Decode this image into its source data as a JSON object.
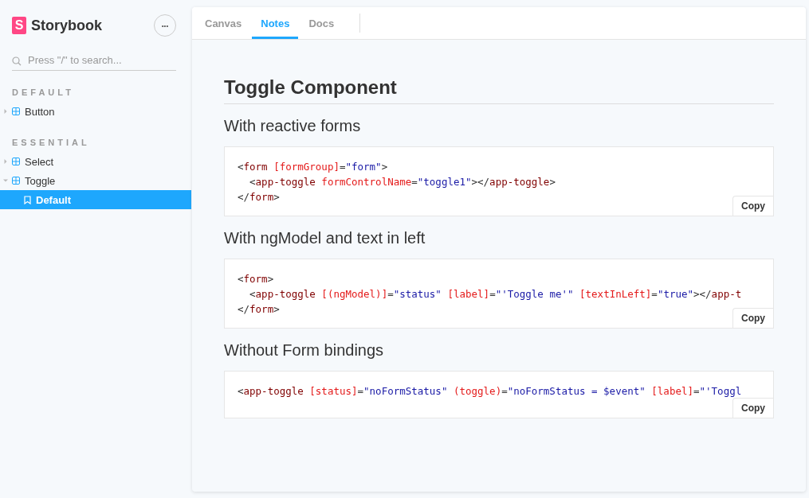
{
  "sidebar": {
    "brand": {
      "logo_letter": "S",
      "name": "Storybook"
    },
    "menu_button": "•••",
    "search": {
      "placeholder": "Press \"/\" to search..."
    },
    "sections": [
      {
        "heading": "DEFAULT",
        "items": [
          {
            "label": "Button",
            "expanded": false,
            "selected": false
          }
        ]
      },
      {
        "heading": "ESSENTIAL",
        "items": [
          {
            "label": "Select",
            "expanded": false,
            "selected": false
          },
          {
            "label": "Toggle",
            "expanded": true,
            "selected": false,
            "children": [
              {
                "label": "Default",
                "selected": true
              }
            ]
          }
        ]
      }
    ]
  },
  "tabs": [
    {
      "label": "Canvas",
      "selected": false
    },
    {
      "label": "Notes",
      "selected": true
    },
    {
      "label": "Docs",
      "selected": false
    }
  ],
  "doc": {
    "title": "Toggle Component",
    "sections": [
      {
        "heading": "With reactive forms",
        "copy": "Copy",
        "lines": [
          [
            {
              "kind": "punct",
              "t": "<"
            },
            {
              "kind": "tag",
              "t": "form"
            },
            {
              "kind": "attr",
              "t": " [formGroup]"
            },
            {
              "kind": "punct",
              "t": "="
            },
            {
              "kind": "value",
              "t": "\"form\""
            },
            {
              "kind": "punct",
              "t": ">"
            }
          ],
          [
            {
              "kind": "punct",
              "t": "  <"
            },
            {
              "kind": "tag",
              "t": "app-toggle"
            },
            {
              "kind": "attr",
              "t": " formControlName"
            },
            {
              "kind": "punct",
              "t": "="
            },
            {
              "kind": "value",
              "t": "\"toggle1\""
            },
            {
              "kind": "punct",
              "t": "></"
            },
            {
              "kind": "tag",
              "t": "app-toggle"
            },
            {
              "kind": "punct",
              "t": ">"
            }
          ],
          [
            {
              "kind": "punct",
              "t": "</"
            },
            {
              "kind": "tag",
              "t": "form"
            },
            {
              "kind": "punct",
              "t": ">"
            }
          ]
        ]
      },
      {
        "heading": "With ngModel and text in left",
        "copy": "Copy",
        "lines": [
          [
            {
              "kind": "punct",
              "t": "<"
            },
            {
              "kind": "tag",
              "t": "form"
            },
            {
              "kind": "punct",
              "t": ">"
            }
          ],
          [
            {
              "kind": "punct",
              "t": "  <"
            },
            {
              "kind": "tag",
              "t": "app-toggle"
            },
            {
              "kind": "attr",
              "t": " [(ngModel)]"
            },
            {
              "kind": "punct",
              "t": "="
            },
            {
              "kind": "value",
              "t": "\"status\""
            },
            {
              "kind": "attr",
              "t": " [label]"
            },
            {
              "kind": "punct",
              "t": "="
            },
            {
              "kind": "value",
              "t": "\"'Toggle me'\""
            },
            {
              "kind": "attr",
              "t": " [textInLeft]"
            },
            {
              "kind": "punct",
              "t": "="
            },
            {
              "kind": "value",
              "t": "\"true\""
            },
            {
              "kind": "punct",
              "t": "></"
            },
            {
              "kind": "tag",
              "t": "app-t"
            }
          ],
          [
            {
              "kind": "punct",
              "t": "</"
            },
            {
              "kind": "tag",
              "t": "form"
            },
            {
              "kind": "punct",
              "t": ">"
            }
          ]
        ]
      },
      {
        "heading": "Without Form bindings",
        "copy": "Copy",
        "lines": [
          [
            {
              "kind": "punct",
              "t": "<"
            },
            {
              "kind": "tag",
              "t": "app-toggle"
            },
            {
              "kind": "attr",
              "t": " [status]"
            },
            {
              "kind": "punct",
              "t": "="
            },
            {
              "kind": "value",
              "t": "\"noFormStatus\""
            },
            {
              "kind": "attr",
              "t": " (toggle)"
            },
            {
              "kind": "punct",
              "t": "="
            },
            {
              "kind": "value",
              "t": "\"noFormStatus = $event\""
            },
            {
              "kind": "attr",
              "t": " [label]"
            },
            {
              "kind": "punct",
              "t": "="
            },
            {
              "kind": "value",
              "t": "\"'Toggl"
            }
          ]
        ]
      }
    ]
  }
}
